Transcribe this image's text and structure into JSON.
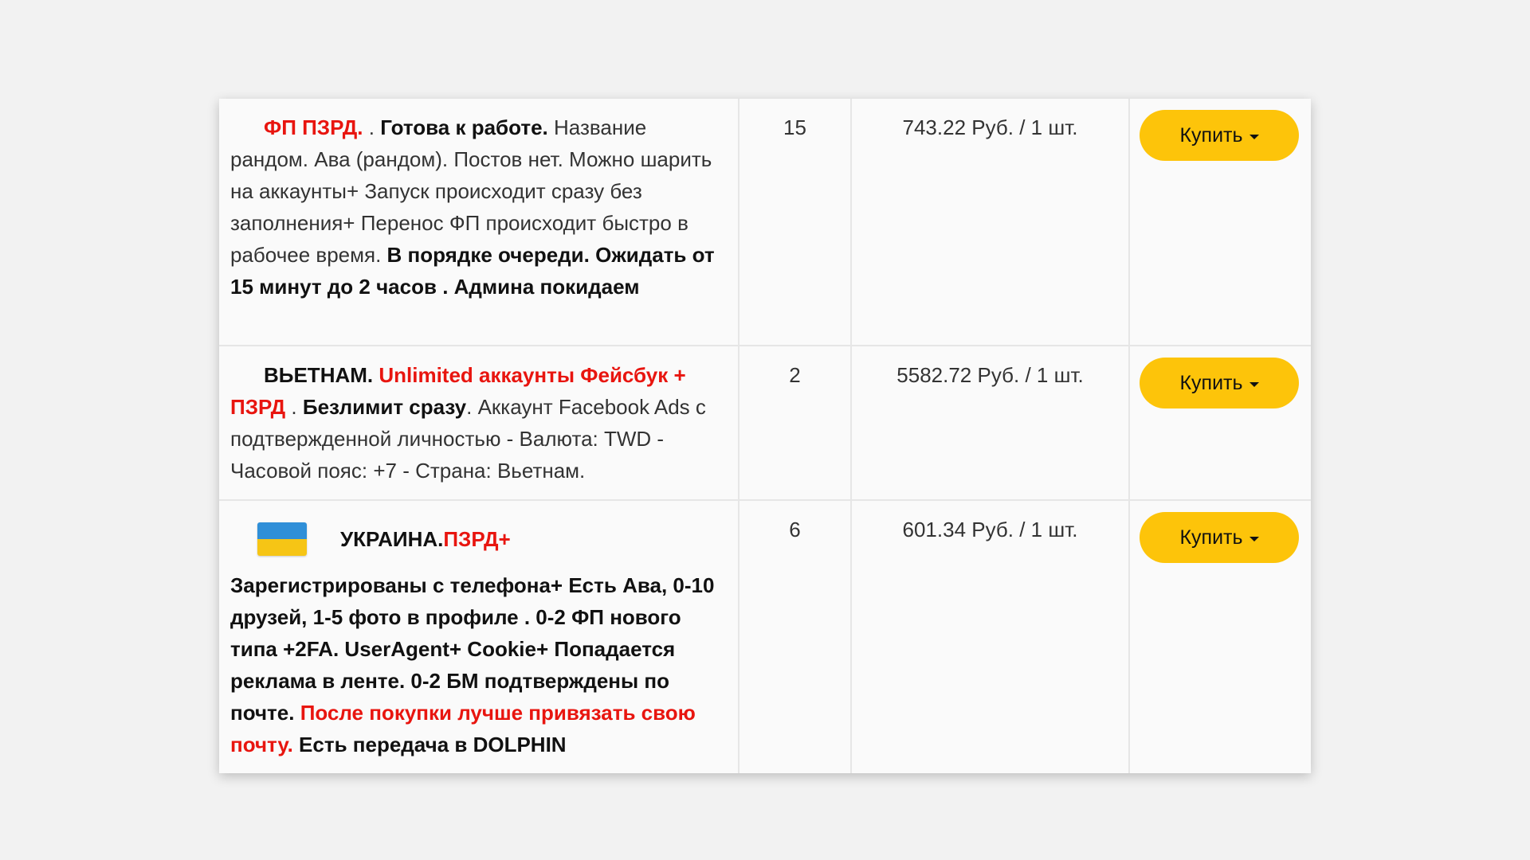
{
  "colors": {
    "accent_red": "#e8150f",
    "button_yellow": "#fdc40a",
    "flag_blue": "#2f8fd8",
    "flag_yellow": "#f6c515"
  },
  "rows": [
    {
      "desc": {
        "p1": "ФП ПЗРД.",
        "p2": " . ",
        "p3": "Готова к работе.",
        "p4": " Название рандом. Ава (рандом). Постов нет. Можно шарить на аккаунты+ Запуск происходит сразу без заполнения+ Перенос ФП происходит быстро в рабочее время. ",
        "p5": "В порядке очереди. Ожидать от 15 минут до 2 часов . Админа покидаем"
      },
      "qty": "15",
      "price": "743.22 Руб. / 1 шт.",
      "buy_label": "Купить"
    },
    {
      "desc": {
        "p1": "ВЬЕТНАМ. ",
        "p2": "Unlimited аккаунты Фейсбук + ПЗРД",
        "p3": " . ",
        "p4": "Безлимит сразу",
        "p5": ". Аккаунт Facebook Ads с подтвержденной личностью - Валюта: TWD - Часовой пояс: +7 - Страна: Вьетнам."
      },
      "qty": "2",
      "price": "5582.72 Руб. / 1 шт.",
      "buy_label": "Купить"
    },
    {
      "flag_icon": "ukraine-flag-icon",
      "desc": {
        "p1": "УКРАИНА. ",
        "p2": "ПЗРД+",
        "p3": "Зарегистрированы с телефона+ Есть Ава, 0-10 друзей, 1-5 фото в профиле . 0-2 ФП нового типа +2FA. UserAgent+ Cookie+ Попадается реклама в ленте. 0-2 БМ подтверждены по почте. ",
        "p4": "После покупки лучше привязать свою почту.",
        "p5": " Есть передача в DOLPHIN"
      },
      "qty": "6",
      "price": "601.34 Руб. / 1 шт.",
      "buy_label": "Купить"
    }
  ]
}
